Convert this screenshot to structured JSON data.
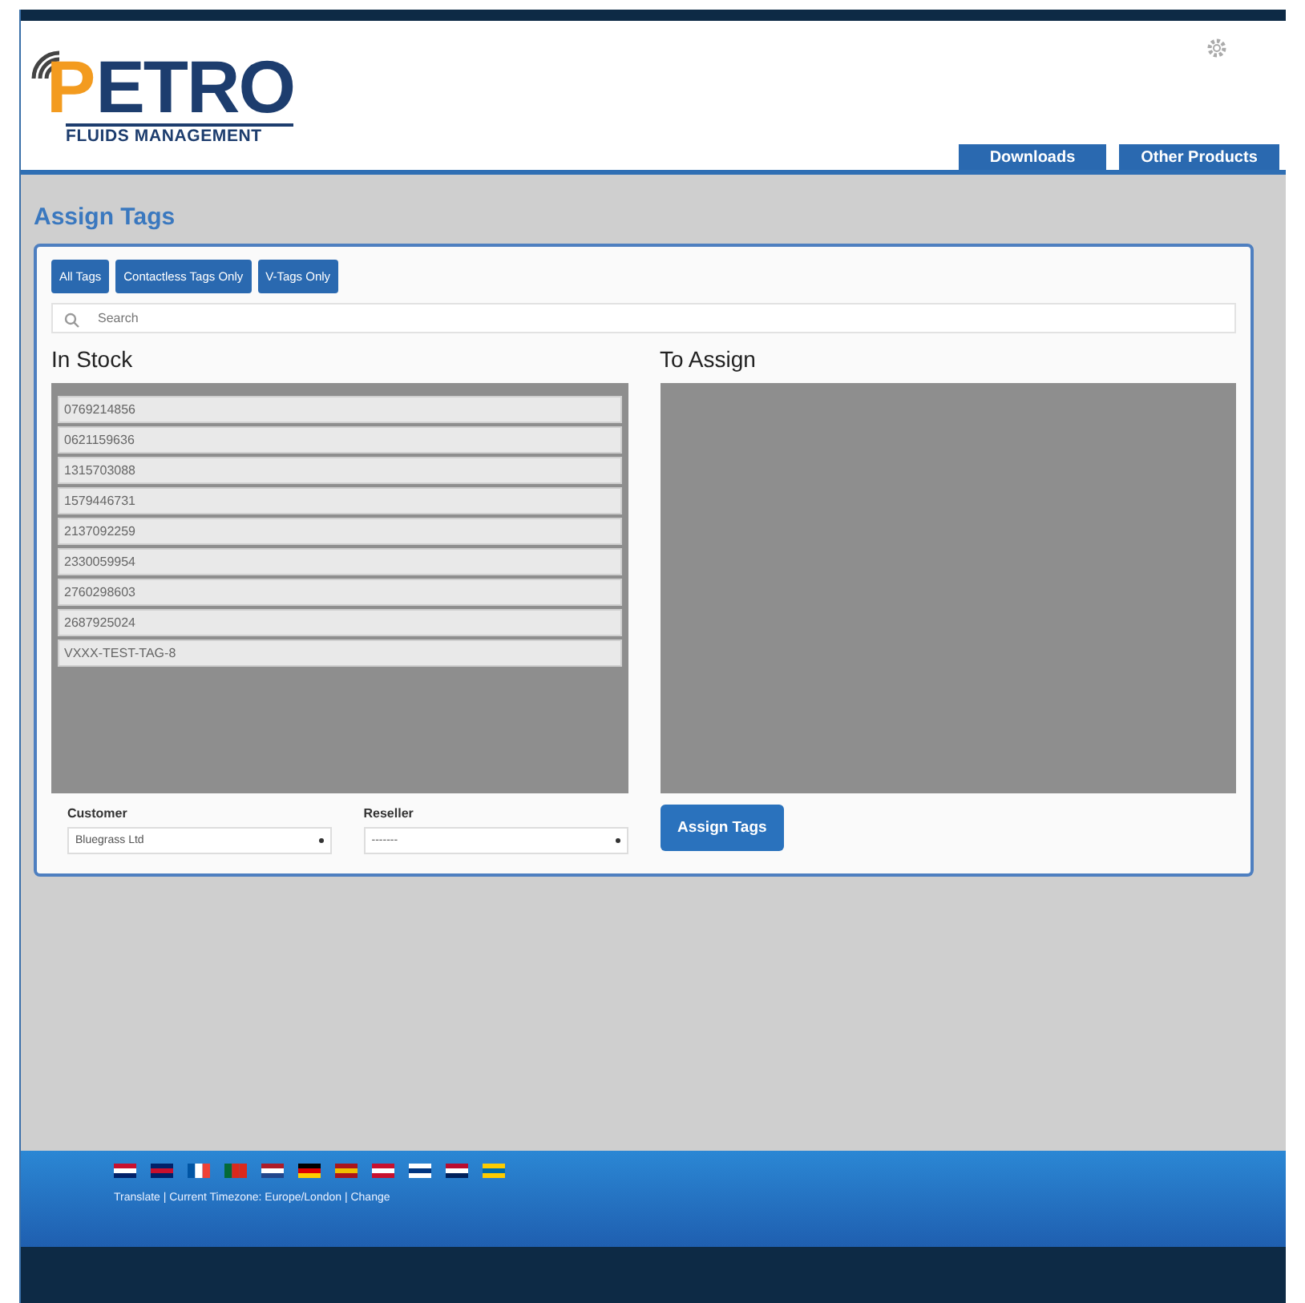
{
  "header": {
    "logo": {
      "mark": "P",
      "name": "ETRO",
      "tagline": "FLUIDS MANAGEMENT"
    },
    "nav": [
      "Downloads",
      "Other Products"
    ]
  },
  "page_title": "Assign Tags",
  "filters": [
    "All Tags",
    "Contactless Tags Only",
    "V-Tags Only"
  ],
  "search": {
    "placeholder": "Search"
  },
  "in_stock": {
    "title": "In Stock",
    "items": [
      "0769214856",
      "0621159636",
      "1315703088",
      "1579446731",
      "2137092259",
      "2330059954",
      "2760298603",
      "2687925024",
      "VXXX-TEST-TAG-8"
    ]
  },
  "to_assign": {
    "title": "To Assign"
  },
  "customer": {
    "label": "Customer",
    "value": "Bluegrass Ltd"
  },
  "reseller": {
    "label": "Reseller",
    "value": "-------"
  },
  "assign_button": "Assign Tags",
  "footer": {
    "text": "Translate | Current Timezone: Europe/London | Change"
  }
}
